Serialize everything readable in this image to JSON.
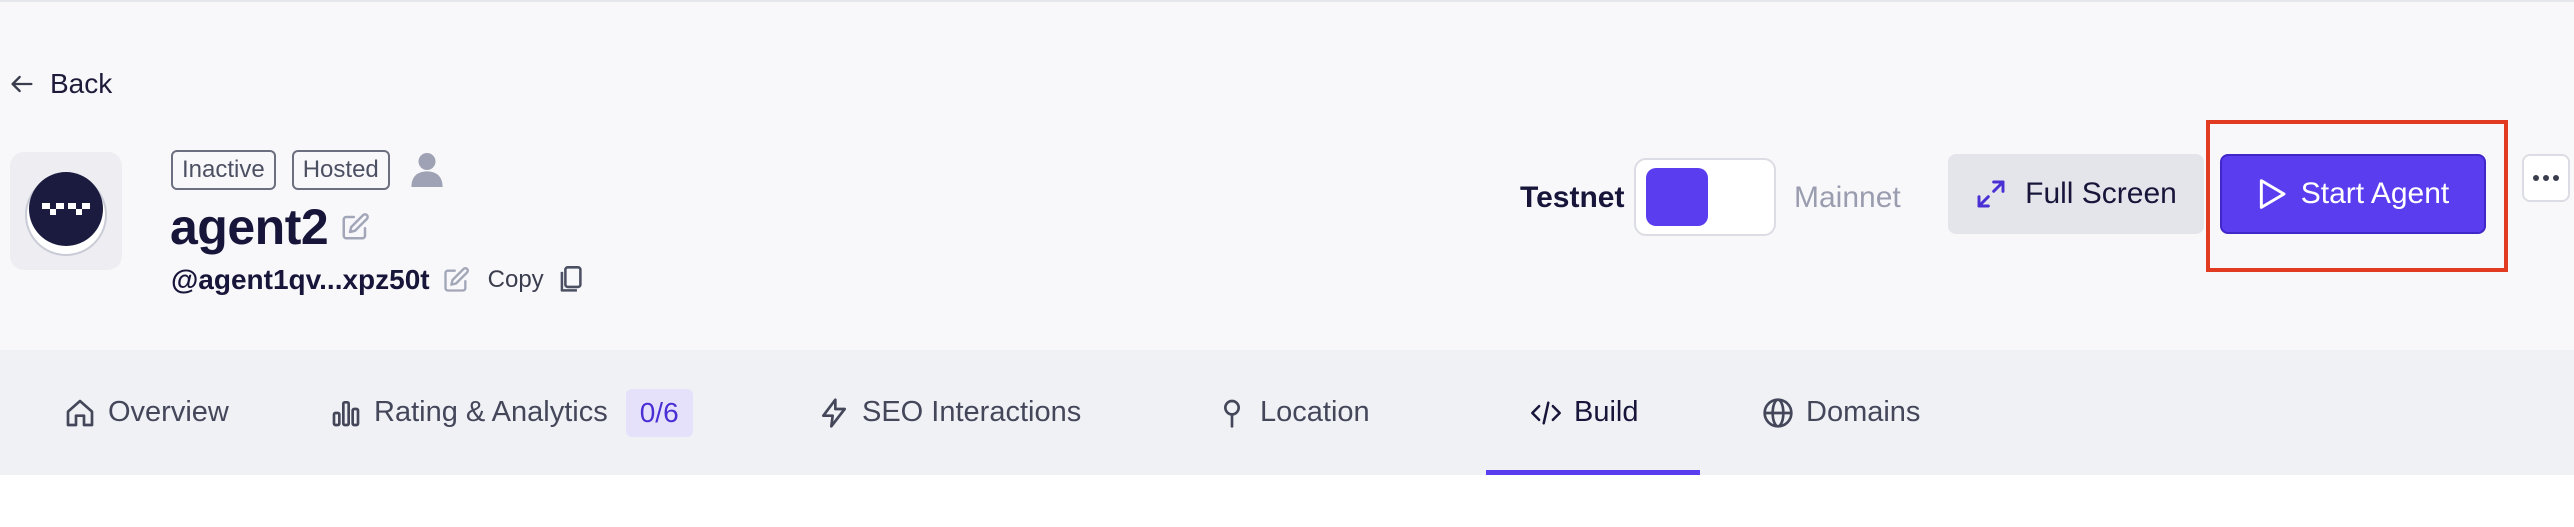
{
  "nav": {
    "back_label": "Back"
  },
  "agent": {
    "status_badge": "Inactive",
    "hosting_badge": "Hosted",
    "name": "agent2",
    "handle": "@agent1qv...xpz50t",
    "copy_label": "Copy"
  },
  "network": {
    "testnet_label": "Testnet",
    "mainnet_label": "Mainnet",
    "selected": "Testnet"
  },
  "actions": {
    "full_screen_label": "Full Screen",
    "start_agent_label": "Start Agent",
    "more_icon": "more-horizontal-icon"
  },
  "tabs": [
    {
      "label": "Overview",
      "icon": "home-icon"
    },
    {
      "label": "Rating & Analytics",
      "icon": "bar-chart-icon",
      "badge": "0/6"
    },
    {
      "label": "SEO Interactions",
      "icon": "lightning-icon"
    },
    {
      "label": "Location",
      "icon": "location-pin-icon"
    },
    {
      "label": "Build",
      "icon": "code-icon",
      "active": true
    },
    {
      "label": "Domains",
      "icon": "globe-icon"
    }
  ],
  "colors": {
    "accent": "#5b3df0",
    "highlight": "#e13b22",
    "header_bg": "#f8f8fa",
    "tabs_bg": "#f0f1f5"
  }
}
